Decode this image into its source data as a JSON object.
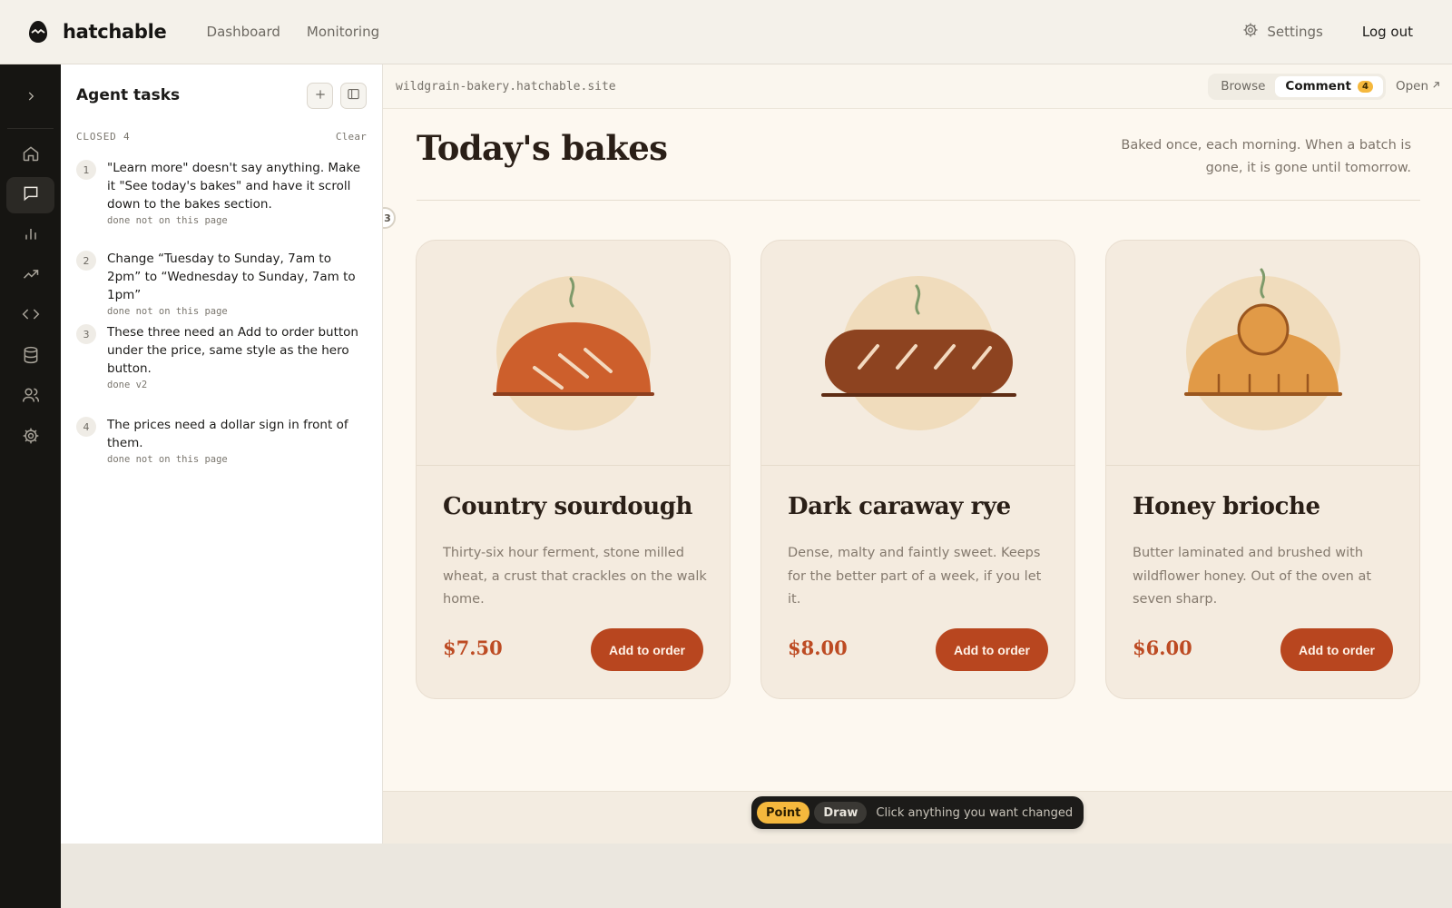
{
  "app": {
    "brand": "hatchable",
    "nav": [
      "Dashboard",
      "Monitoring"
    ],
    "settings_label": "Settings",
    "logout_label": "Log out"
  },
  "tasks_panel": {
    "title": "Agent tasks",
    "closed_label": "CLOSED 4",
    "clear_label": "Clear",
    "items": [
      {
        "num": "1",
        "text": "\"Learn more\" doesn't say anything. Make it \"See today's bakes\" and have it scroll down to the bakes section.",
        "meta": "done not on this page"
      },
      {
        "num": "2",
        "text": "Change “Tuesday to Sunday, 7am to 2pm” to “Wednesday to Sunday, 7am to 1pm”",
        "meta": "done not on this page"
      },
      {
        "num": "3",
        "text": "These three need an Add to order button under the price, same style as the hero button.",
        "meta": "done v2"
      },
      {
        "num": "4",
        "text": "The prices need a dollar sign in front of them.",
        "meta": "done not on this page"
      }
    ]
  },
  "preview": {
    "url": "wildgrain-bakery.hatchable.site",
    "modes": [
      "Browse",
      "Comment"
    ],
    "comment_count": "4",
    "open_label": "Open",
    "pin_number": "3",
    "page_title": "Today's bakes",
    "page_subtitle": "Baked once, each morning. When a batch is gone, it is gone until tomorrow.",
    "cards": [
      {
        "name": "Country sourdough",
        "desc": "Thirty-six hour ferment, stone milled wheat, a crust that crackles on the walk home.",
        "price": "$7.50",
        "button": "Add to order"
      },
      {
        "name": "Dark caraway rye",
        "desc": "Dense, malty and faintly sweet. Keeps for the better part of a week, if you let it.",
        "price": "$8.00",
        "button": "Add to order"
      },
      {
        "name": "Honey brioche",
        "desc": "Butter laminated and brushed with wildflower honey. Out of the oven at seven sharp.",
        "price": "$6.00",
        "button": "Add to order"
      }
    ],
    "toolbar": {
      "point_label": "Point",
      "draw_label": "Draw",
      "hint": "Click anything you want changed"
    }
  },
  "colors": {
    "accent": "#b8461f",
    "price": "#bd4b23",
    "badge": "#f5b83d",
    "rail": "#161512"
  },
  "icons": {
    "rail": [
      "chevron-right-icon",
      "home-icon",
      "chat-icon",
      "bar-chart-icon",
      "trending-icon",
      "code-icon",
      "database-icon",
      "users-icon",
      "gear-icon"
    ]
  }
}
